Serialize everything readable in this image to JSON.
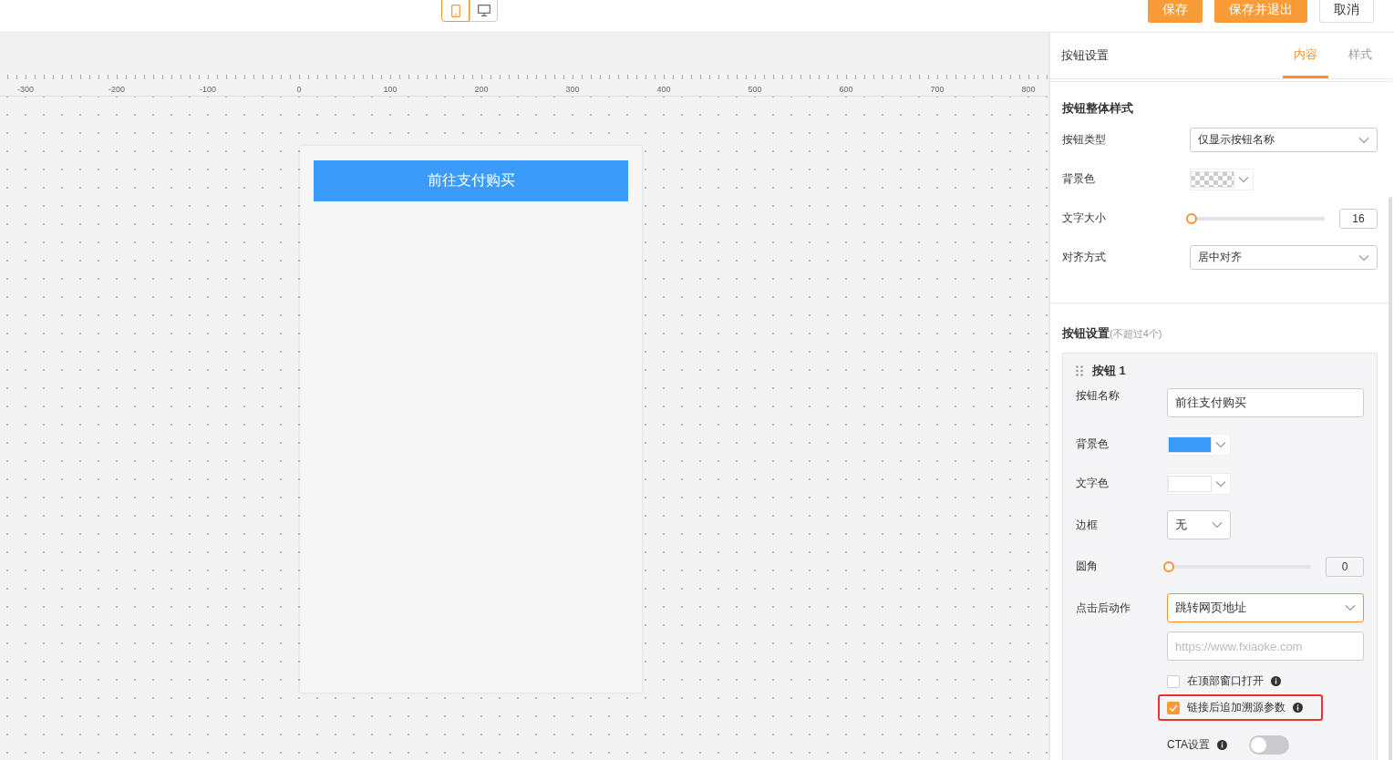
{
  "device_toggle": [
    {
      "kind": "mobile",
      "selected": true
    },
    {
      "kind": "desktop",
      "selected": false
    }
  ],
  "actions": [
    {
      "label": "保存",
      "kind": "primary"
    },
    {
      "label": "保存并退出",
      "kind": "primary"
    },
    {
      "label": "取消",
      "kind": "plain"
    }
  ],
  "ruler": {
    "labels": [
      "-300",
      "-200",
      "-100",
      "0",
      "100",
      "200",
      "300",
      "400",
      "500",
      "600",
      "700",
      "800"
    ]
  },
  "preview": {
    "button_label": "前往支付购买"
  },
  "panel": {
    "title": "按钮设置",
    "tabs": [
      {
        "label": "内容",
        "selected": true
      },
      {
        "label": "样式",
        "selected": false
      }
    ],
    "overall": {
      "title": "按钮整体样式",
      "rows": [
        {
          "kind": "select",
          "label": "按钮类型",
          "value": "仅显示按钮名称"
        },
        {
          "kind": "color",
          "label": "背景色"
        },
        {
          "kind": "slider",
          "label": "文字大小",
          "level": 0,
          "value": "16"
        },
        {
          "kind": "select",
          "label": "对齐方式",
          "value": "居中对齐"
        }
      ]
    },
    "buttons_section": {
      "title": "按钮设置",
      "note": "(不超过4个)",
      "items": [
        {
          "title": "按钮 1",
          "rows": [
            {
              "kind": "text",
              "label": "按钮名称",
              "value": "前往支付购买"
            },
            {
              "kind": "color",
              "label": "背景色",
              "color": "#3a9bfa"
            },
            {
              "kind": "color",
              "label": "文字色",
              "color": "#ffffff"
            },
            {
              "kind": "small-select",
              "label": "边框",
              "value": "无"
            },
            {
              "kind": "slider",
              "label": "圆角",
              "level": 0,
              "value": "0"
            },
            {
              "kind": "select",
              "label": "点击后动作",
              "value": "跳转网页地址",
              "focused": true
            }
          ],
          "url_placeholder": "https://www.fxiaoke.com",
          "options": [
            {
              "label": "在顶部窗口打开",
              "checked": false,
              "highlighted": false
            },
            {
              "label": "链接后追加溯源参数",
              "checked": true,
              "highlighted": true
            }
          ],
          "cta": {
            "label": "CTA设置",
            "on": false
          }
        }
      ]
    }
  }
}
